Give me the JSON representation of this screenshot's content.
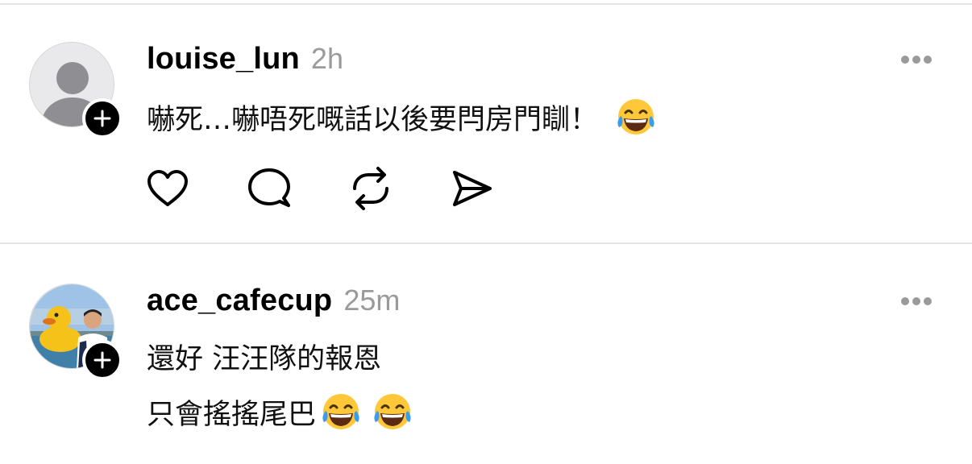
{
  "posts": [
    {
      "username": "louise_lun",
      "time": "2h",
      "lines": [
        "嚇死…嚇唔死嘅話以後要閂房門瞓！"
      ],
      "line_emojis": [
        1
      ],
      "avatar": "default-avatar-icon",
      "follow_icon": "plus-icon",
      "more_icon": "more-dots-icon",
      "actions": [
        "heart-icon",
        "comment-icon",
        "repost-icon",
        "share-icon"
      ]
    },
    {
      "username": "ace_cafecup",
      "time": "25m",
      "lines": [
        "還好 汪汪隊的報恩",
        "只會搖搖尾巴"
      ],
      "line_emojis": [
        0,
        2
      ],
      "avatar": "rubber-duck-selfie-photo",
      "follow_icon": "plus-icon",
      "more_icon": "more-dots-icon"
    }
  ],
  "emoji": "😂",
  "colors": {
    "text": "#000000",
    "secondary": "#9a9a9a",
    "divider": "#e4e4e4",
    "badge": "#000000"
  }
}
